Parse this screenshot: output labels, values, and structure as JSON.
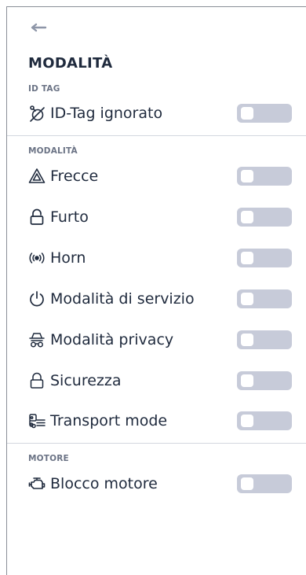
{
  "page": {
    "title": "MODALITÀ"
  },
  "sections": {
    "idtag": {
      "label": "ID TAG",
      "items": [
        {
          "label": "ID-Tag ignorato",
          "icon": "tag-off-icon",
          "on": false
        }
      ]
    },
    "modalita": {
      "label": "MODALITÀ",
      "items": [
        {
          "label": "Frecce",
          "icon": "hazard-icon",
          "on": false
        },
        {
          "label": "Furto",
          "icon": "lock-open-icon",
          "on": false
        },
        {
          "label": "Horn",
          "icon": "horn-icon",
          "on": false
        },
        {
          "label": "Modalità di servizio",
          "icon": "power-icon",
          "on": false
        },
        {
          "label": "Modalità privacy",
          "icon": "incognito-icon",
          "on": false
        },
        {
          "label": "Sicurezza",
          "icon": "lock-icon",
          "on": false
        },
        {
          "label": "Transport mode",
          "icon": "tow-truck-icon",
          "on": false
        }
      ]
    },
    "motore": {
      "label": "MOTORE",
      "items": [
        {
          "label": "Blocco motore",
          "icon": "engine-icon",
          "on": false
        }
      ]
    }
  },
  "colors": {
    "text": "#1f2a3d",
    "section_label": "#6b7385",
    "toggle_off": "#c7cbd9",
    "divider": "#d3d7df"
  }
}
